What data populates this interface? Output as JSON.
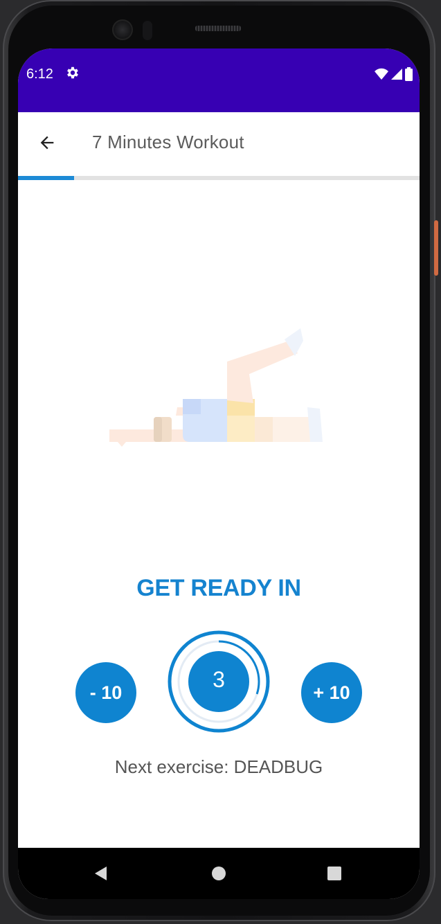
{
  "status_bar": {
    "time": "6:12",
    "settings_icon": "gear-icon",
    "wifi_icon": "wifi-icon",
    "signal_icon": "cell-signal-icon",
    "battery_icon": "battery-icon",
    "background_color": "#3700b3"
  },
  "app_bar": {
    "back_icon": "arrow-left-icon",
    "title": "7 Minutes Workout"
  },
  "progress": {
    "value": 0.14,
    "color": "#1d8ad6"
  },
  "exercise_image": {
    "icon": "deadbug-exercise-illustration"
  },
  "rest": {
    "heading": "GET READY IN",
    "timer_value": "3",
    "timer_progress": 0.3,
    "minus_label": "- 10",
    "plus_label": "+ 10",
    "next_exercise": "Next exercise: DEADBUG",
    "accent_color": "#0f84d0"
  },
  "nav_bar": {
    "back_icon": "triangle-back-icon",
    "home_icon": "circle-home-icon",
    "recents_icon": "square-recents-icon"
  }
}
